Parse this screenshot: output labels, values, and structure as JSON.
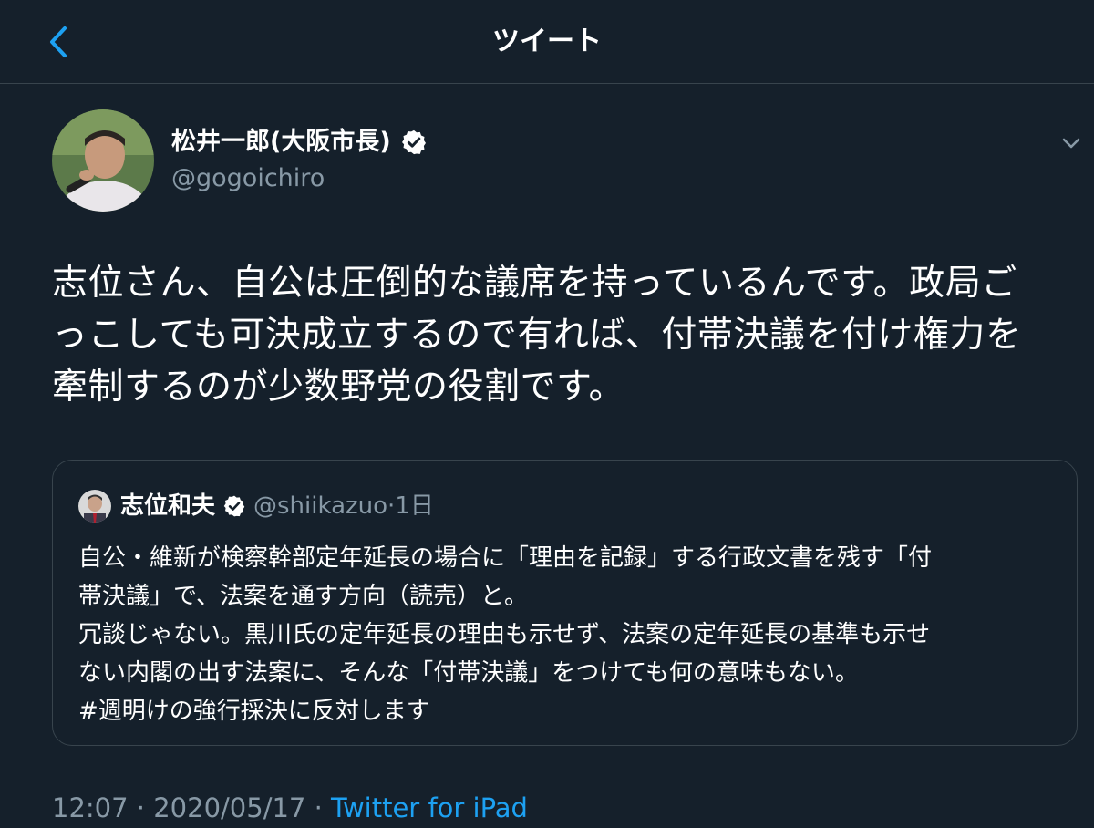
{
  "header": {
    "title": "ツイート",
    "back_icon": "chevron-left-icon"
  },
  "tweet": {
    "author_name": "松井一郎(大阪市長)",
    "handle": "@gogoichiro",
    "lines": [
      "志位さん、自公は圧倒的な議席を持っているんです。政局ご",
      "っこしても可決成立するので有れば、付帯決議を付け権力を",
      "牽制するのが少数野党の役割です。"
    ],
    "timestamp": "12:07 · 2020/05/17 · ",
    "source": "Twitter for iPad"
  },
  "quote": {
    "author_name": "志位和夫",
    "handle_time": "@shiikazuo·1日",
    "lines": [
      "自公・維新が検察幹部定年延長の場合に「理由を記録」する行政文書を残す「付",
      "帯決議」で、法案を通す方向（読売）と。",
      "冗談じゃない。黒川氏の定年延長の理由も示せず、法案の定年延長の基準も示せ",
      "ない内閣の出す法案に、そんな「付帯決議」をつけても何の意味もない。",
      "#週明けの強行採決に反対します"
    ]
  },
  "colors": {
    "background": "#15202b",
    "accent": "#1da1f2",
    "secondary_text": "#8899a6",
    "border": "#38444d"
  }
}
